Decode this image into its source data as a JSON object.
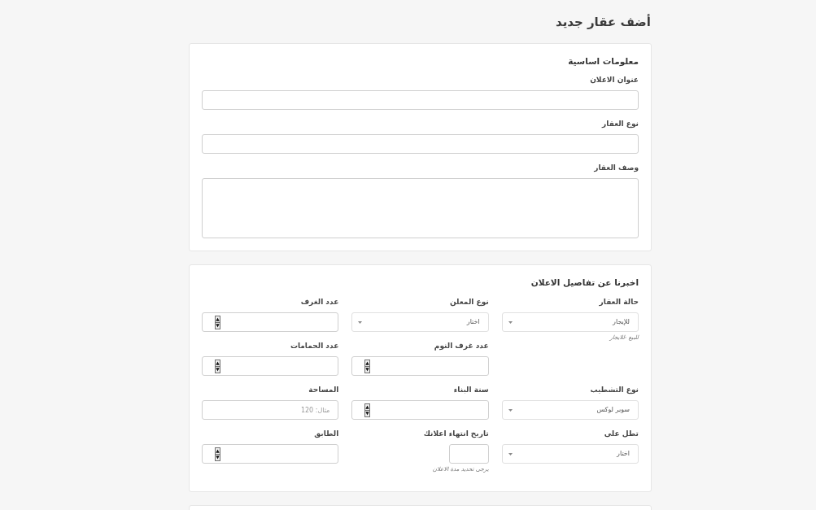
{
  "page_title": "أضف عقار جديد",
  "sections": [
    {
      "kind": "stack",
      "title": "معلومات اساسية",
      "fields": [
        {
          "label": "عنوان الاعلان",
          "kind": "text"
        },
        {
          "label": "نوع العقار",
          "kind": "text"
        },
        {
          "label": "وصف العقار",
          "kind": "textarea"
        }
      ]
    },
    {
      "kind": "grid",
      "title": "اخبرنا عن تفاصيل الاعلان",
      "rows": [
        [
          {
            "label": "حالة العقار",
            "kind": "select",
            "value": "للإيجار",
            "hint": "للبيع -للايجار"
          },
          {
            "label": "نوع المعلن",
            "kind": "select",
            "value": "اختار"
          },
          {
            "label": "عدد الغرف",
            "kind": "number"
          }
        ],
        [
          {
            "kind": "blank"
          },
          {
            "label": "عدد غرف النوم",
            "kind": "number"
          },
          {
            "label": "عدد الحمامات",
            "kind": "number"
          }
        ],
        [
          {
            "label": "نوع التشطيب",
            "kind": "select",
            "value": "سوبر لوكس"
          },
          {
            "label": "سنة البناء",
            "kind": "number"
          },
          {
            "label": "المساحة",
            "kind": "text",
            "placeholder": "مثال: 120"
          }
        ],
        [
          {
            "label": "تطل على",
            "kind": "select",
            "value": "اختار"
          },
          {
            "label": "تاريخ انتهاء اعلانك",
            "kind": "date",
            "hint": "يرجى تحديد مدة الاعلان"
          },
          {
            "label": "الطابق",
            "kind": "number"
          }
        ]
      ]
    },
    {
      "kind": "cut_off"
    }
  ]
}
